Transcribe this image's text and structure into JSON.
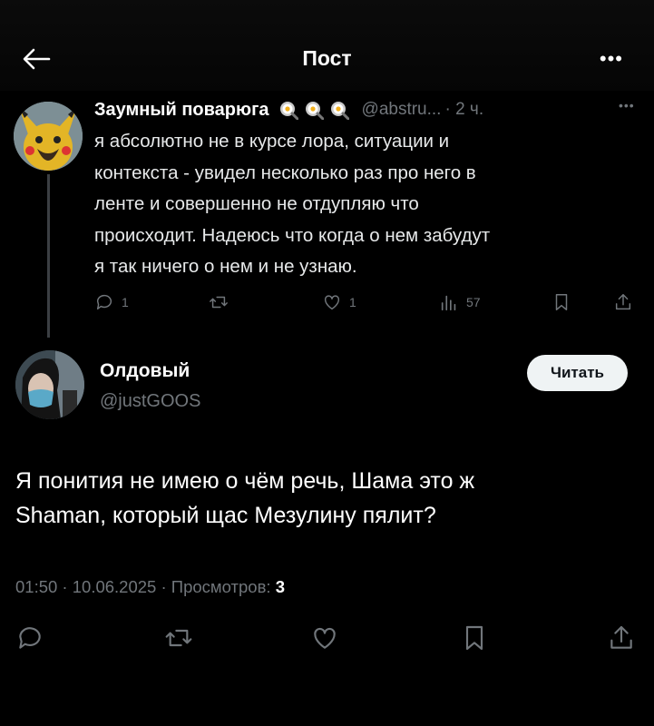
{
  "header": {
    "title": "Пост"
  },
  "tweet1": {
    "author": "Заумный поварюга",
    "badges": [
      "frying-pan-egg-icon",
      "frying-pan-egg-icon",
      "frying-pan-egg-icon"
    ],
    "handle": "@abstru...",
    "time": "· 2 ч.",
    "text": "я абсолютно не в курсе лора, ситуации и\nконтекста - увидел несколько раз про него в\nленте и совершенно не отдупляю что\nпроисходит. Надеюсь что когда о нем забудут\nя так ничего о нем и не узнаю.",
    "actions": {
      "replies": "1",
      "likes": "1",
      "views": "57"
    }
  },
  "tweet2": {
    "author": "Олдовый",
    "handle": "@justGOOS",
    "follow_label": "Читать",
    "text": "Я понития не имею о чём речь, Шама это ж\nShaman, который щас Мезулину пялит?",
    "meta": {
      "time": "01:50",
      "date": "10.06.2025",
      "views_label": "Просмотров:",
      "views": "3"
    }
  },
  "colors": {
    "background": "#000000",
    "text": "#e7e9ea",
    "muted": "#71767b",
    "button_bg": "#eff3f4"
  }
}
